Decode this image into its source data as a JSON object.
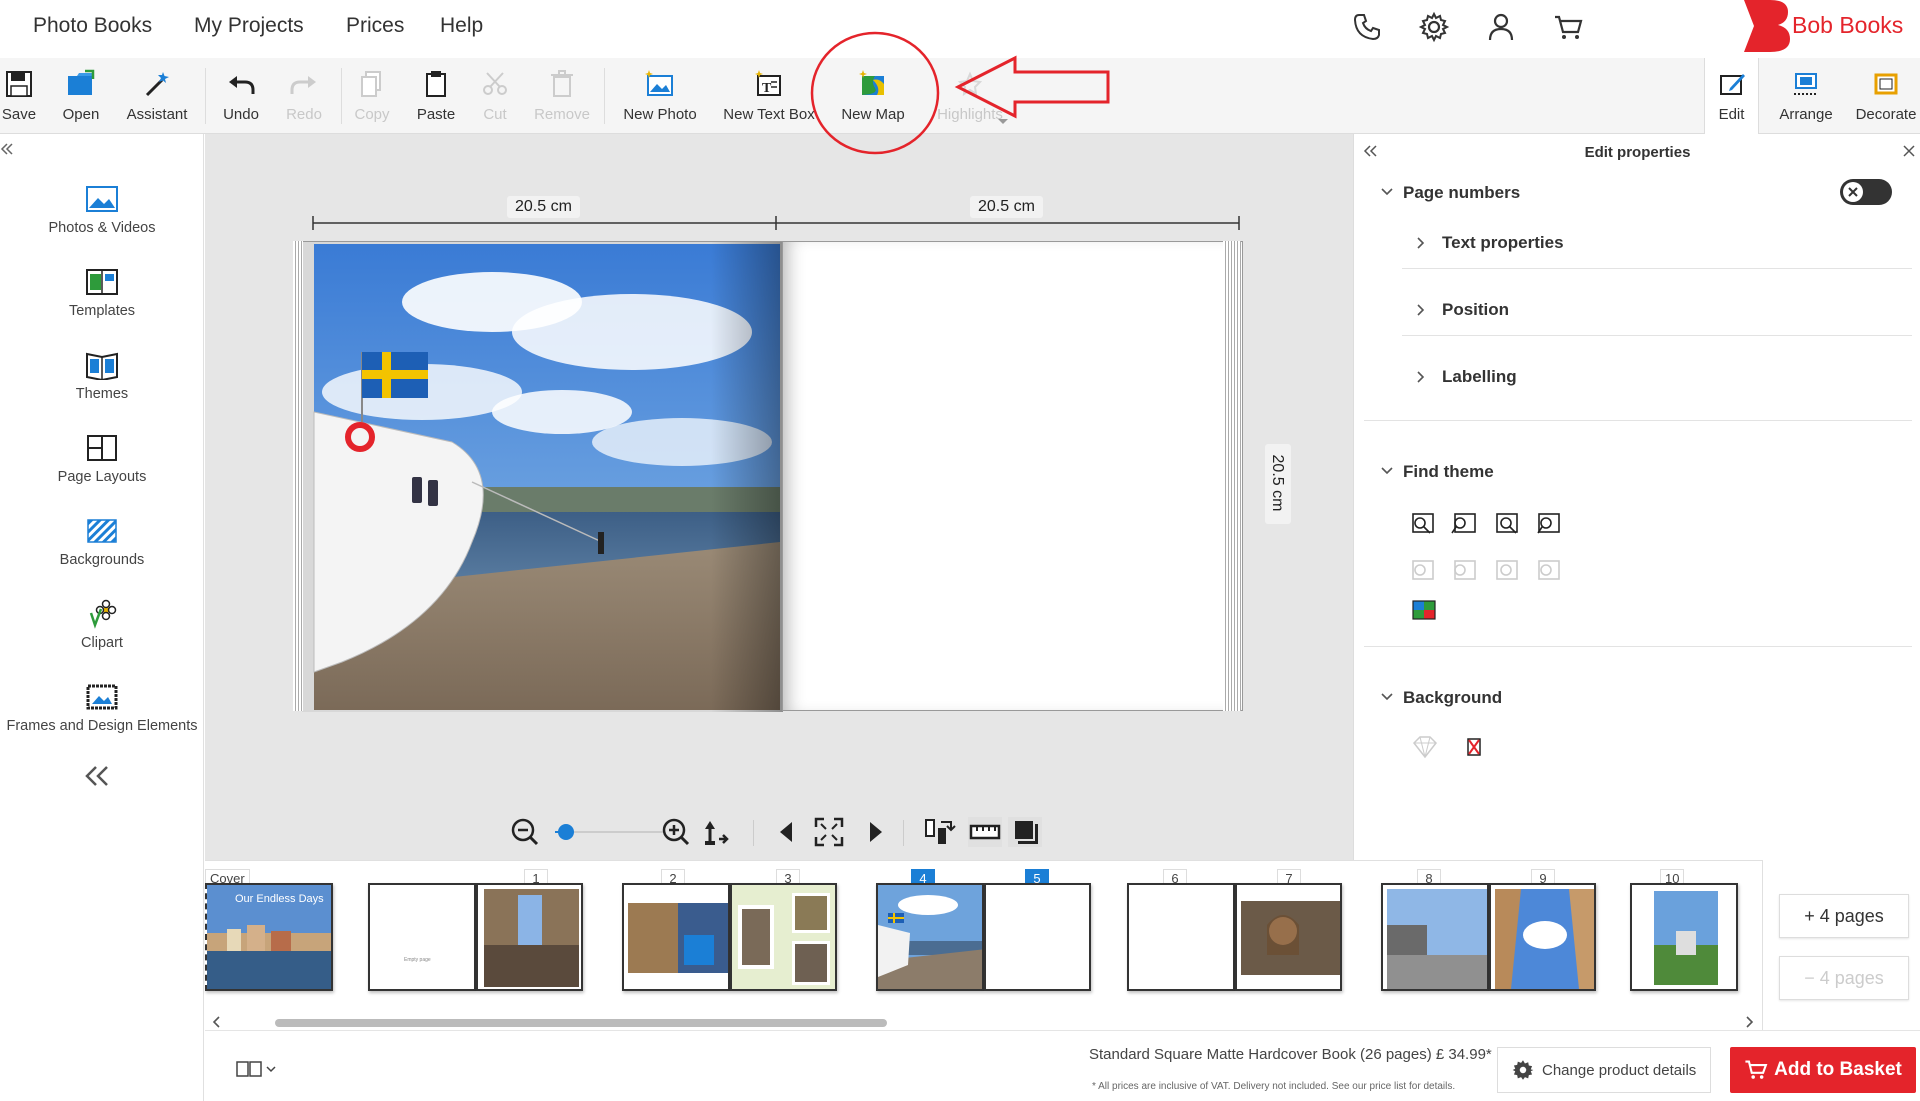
{
  "nav": {
    "links": [
      "Photo Books",
      "My Projects",
      "Prices",
      "Help"
    ],
    "icons": [
      "phone-icon",
      "gear-icon",
      "user-icon",
      "cart-icon"
    ],
    "brand": "Bob Books",
    "brand_color": "#e4242b"
  },
  "toolbar": {
    "save": "Save",
    "open": "Open",
    "assistant": "Assistant",
    "undo": "Undo",
    "redo": "Redo",
    "copy": "Copy",
    "paste": "Paste",
    "cut": "Cut",
    "remove": "Remove",
    "new_photo": "New Photo",
    "new_text_box": "New Text Box",
    "new_map": "New Map",
    "highlights": "Highlights",
    "edit": "Edit",
    "arrange": "Arrange",
    "decorate": "Decorate"
  },
  "sidebar": {
    "items": [
      "Photos & Videos",
      "Templates",
      "Themes",
      "Page Layouts",
      "Backgrounds",
      "Clipart",
      "Frames and Design Elements"
    ]
  },
  "canvas": {
    "width_left": "20.5 cm",
    "width_right": "20.5 cm",
    "height": "20.5 cm"
  },
  "panel": {
    "title": "Edit properties",
    "page_numbers": "Page numbers",
    "text_properties": "Text properties",
    "position": "Position",
    "labelling": "Labelling",
    "find_theme": "Find theme",
    "background": "Background",
    "page_numbers_enabled": false
  },
  "filmstrip": {
    "cover_label": "Cover",
    "cover_title": "Our Endless Days",
    "empty_page": "Empty page",
    "page_numbers": [
      "1",
      "2",
      "3",
      "4",
      "5",
      "6",
      "7",
      "8",
      "9",
      "10"
    ],
    "selected_pages": [
      "4",
      "5"
    ],
    "add_pages": "+ 4 pages",
    "remove_pages": "− 4 pages"
  },
  "footer": {
    "product": "Standard Square Matte Hardcover Book (26 pages) £ 34.99*",
    "note": "* All prices are inclusive of VAT. Delivery not included. See our price list for details.",
    "change_product": "Change product details",
    "add_to_basket": "Add to Basket"
  },
  "zoom": {
    "level": 0.1
  },
  "accent": "#1b7fd6",
  "annotation_color": "#e4242b"
}
